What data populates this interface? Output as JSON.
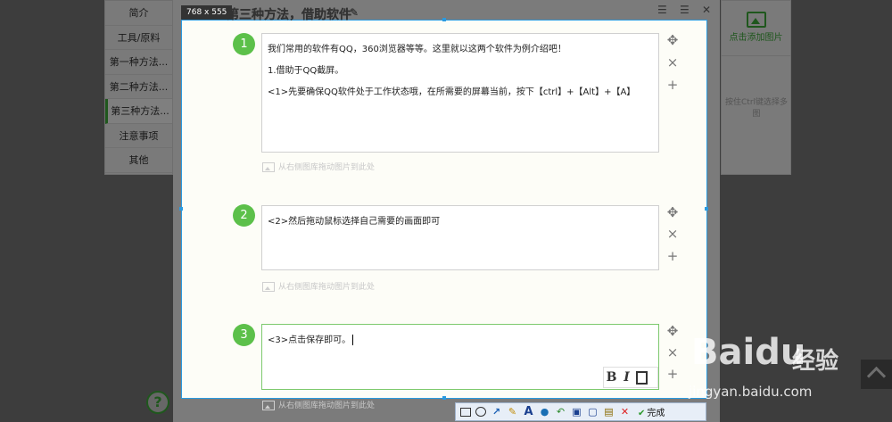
{
  "nav": {
    "items": [
      {
        "label": "简介"
      },
      {
        "label": "工具/原料"
      },
      {
        "label": "第一种方法..."
      },
      {
        "label": "第二种方法..."
      },
      {
        "label": "第三种方法..."
      },
      {
        "label": "注意事项"
      },
      {
        "label": "其他"
      }
    ],
    "active_index": 4
  },
  "header": {
    "title": "第三种方法，借助软件",
    "dimensions_badge": "768 x 555"
  },
  "right_panel": {
    "add_image_label": "点击添加图片",
    "multi_select_hint": "按住Ctrl键选择多图"
  },
  "steps": [
    {
      "number": "1",
      "lines": [
        "我们常用的软件有QQ，360浏览器等等。这里就以这两个软件为例介绍吧！",
        "1.借助于QQ截屏。",
        "<1>先要确保QQ软件处于工作状态哦，在所需要的屏幕当前，按下【ctrl】+【Alt】+【A】"
      ],
      "drag_hint": "从右侧图库拖动图片到此处"
    },
    {
      "number": "2",
      "lines": [
        "<2>然后拖动鼠标选择自己需要的画面即可"
      ],
      "drag_hint": "从右侧图库拖动图片到此处"
    },
    {
      "number": "3",
      "lines": [
        "<3>点击保存即可。"
      ],
      "drag_hint": "从右侧图库拖动图片到此处"
    }
  ],
  "format_toolbar": {
    "bold": "B",
    "italic": "I"
  },
  "step_controls": {
    "move": "✥",
    "delete": "×",
    "add": "+"
  },
  "annotation_toolbar": {
    "text_tool": "A",
    "done_label": "完成"
  },
  "help_label": "?",
  "watermark": {
    "brand": "Baidu",
    "product": "经验",
    "url": "jingyan.baidu.com"
  }
}
